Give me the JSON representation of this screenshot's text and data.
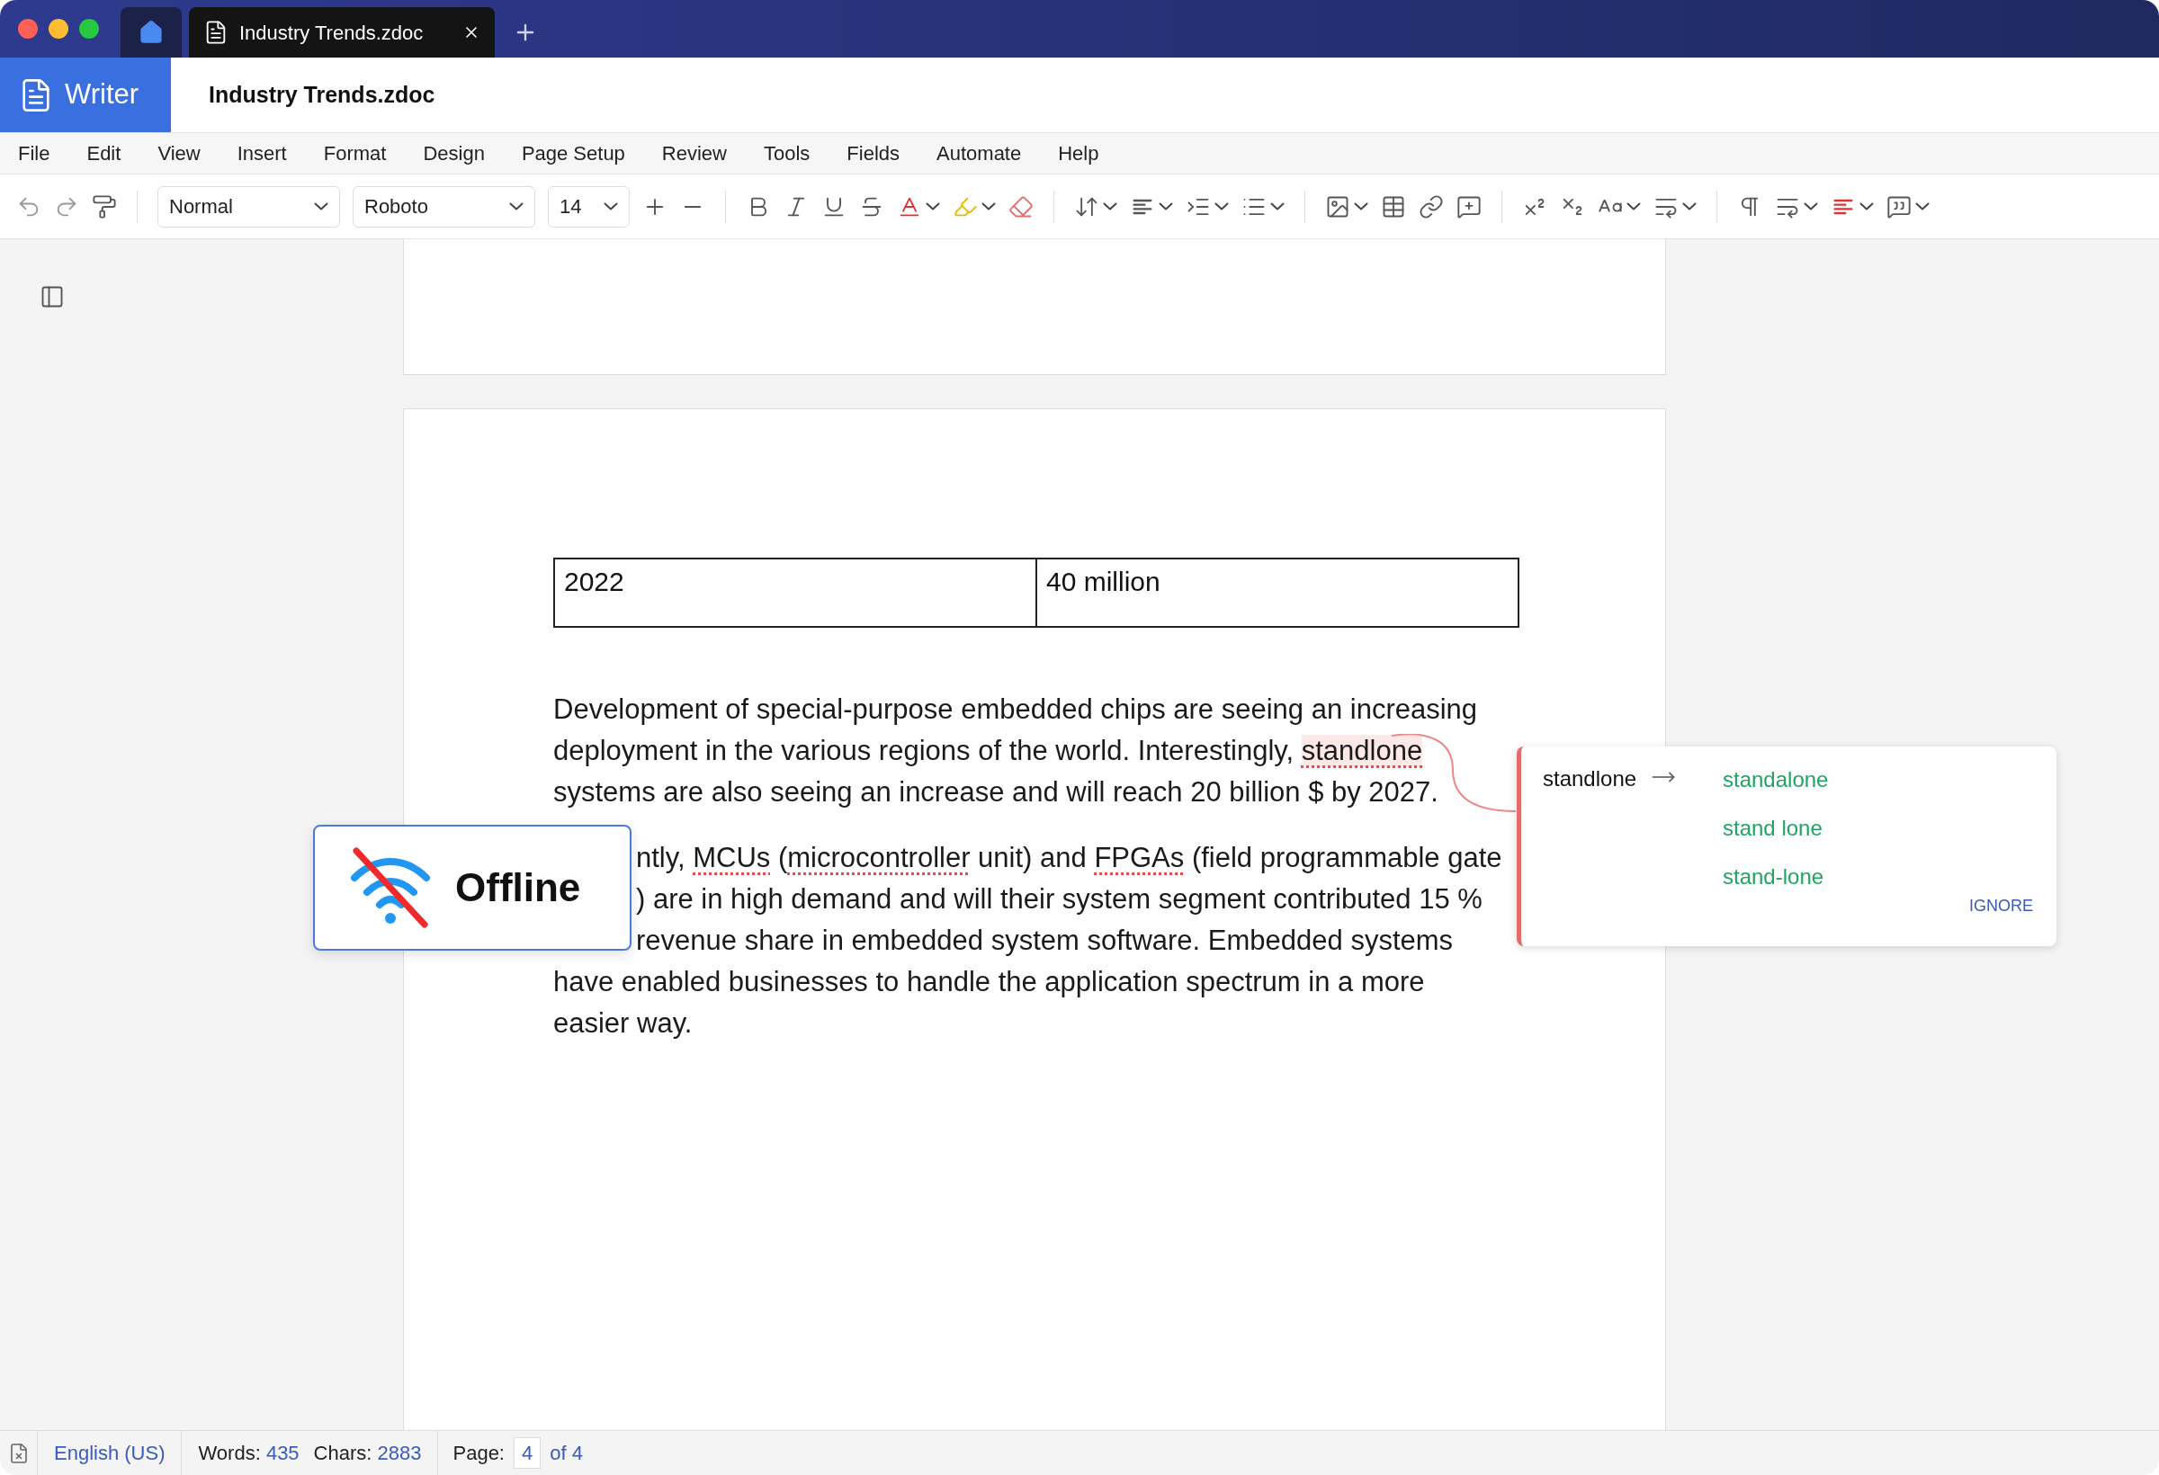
{
  "window": {
    "tabs": [
      {
        "kind": "home",
        "selected": false
      },
      {
        "kind": "document",
        "label": "Industry Trends.zdoc",
        "selected": true
      }
    ]
  },
  "app": {
    "name": "Writer",
    "document_title": "Industry Trends.zdoc"
  },
  "menu": [
    "File",
    "Edit",
    "View",
    "Insert",
    "Format",
    "Design",
    "Page Setup",
    "Review",
    "Tools",
    "Fields",
    "Automate",
    "Help"
  ],
  "toolbar": {
    "style": "Normal",
    "font": "Roboto",
    "size": "14"
  },
  "document": {
    "table": [
      [
        "2022",
        "40 million"
      ]
    ],
    "paragraphs": [
      {
        "lines": [
          {
            "covered": false,
            "segments": [
              {
                "text": "Development of special-purpose embedded chips are seeing an increasing",
                "kind": "plain"
              }
            ]
          },
          {
            "covered": false,
            "segments": [
              {
                "text": "deployment in the various regions of the world. Interestingly, ",
                "kind": "plain"
              },
              {
                "text": "standlone",
                "kind": "active_misspelled"
              }
            ]
          },
          {
            "covered": false,
            "segments": [
              {
                "text": "systems are also seeing an increase and will reach 20 billion $ by 2027.",
                "kind": "plain"
              }
            ]
          }
        ]
      },
      {
        "lines": [
          {
            "covered": true,
            "segments": [
              {
                "text": "ntly, ",
                "kind": "plain"
              },
              {
                "text": "MCUs",
                "kind": "misspelled"
              },
              {
                "text": " (",
                "kind": "plain"
              },
              {
                "text": "microcontroller",
                "kind": "misspelled"
              },
              {
                "text": " unit) and ",
                "kind": "plain"
              },
              {
                "text": "FPGAs",
                "kind": "misspelled"
              },
              {
                "text": " (field programmable gate",
                "kind": "plain"
              }
            ]
          },
          {
            "covered": true,
            "segments": [
              {
                "text": ") are in high demand and will their system segment contributed 15 %",
                "kind": "plain"
              }
            ]
          },
          {
            "covered": true,
            "segments": [
              {
                "text": "revenue share in embedded system software. Embedded systems",
                "kind": "plain"
              }
            ]
          },
          {
            "covered": false,
            "segments": [
              {
                "text": "have enabled businesses to handle the application spectrum in a more",
                "kind": "plain"
              }
            ]
          },
          {
            "covered": false,
            "segments": [
              {
                "text": "easier way.",
                "kind": "plain"
              }
            ]
          }
        ]
      }
    ]
  },
  "spell_popup": {
    "word": "standlone",
    "suggestions": [
      "standalone",
      "stand lone",
      "stand-lone"
    ],
    "ignore": "IGNORE"
  },
  "offline_toast": {
    "label": "Offline"
  },
  "status_bar": {
    "language": "English (US)",
    "words_label": "Words:",
    "words": "435",
    "chars_label": "Chars:",
    "chars": "2883",
    "page_label": "Page:",
    "page": "4",
    "page_total": "of 4"
  }
}
